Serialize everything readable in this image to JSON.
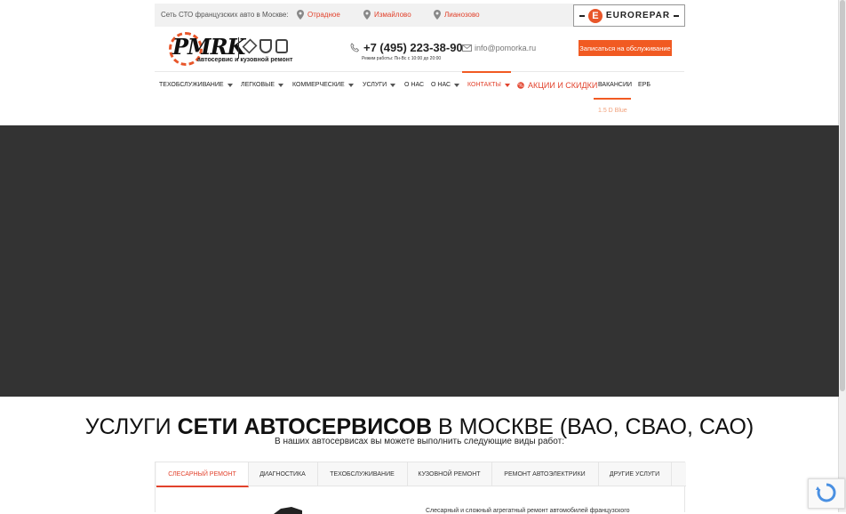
{
  "topbar": {
    "lead": "Сеть СТО французских авто в Москве:",
    "locations": [
      "Отрадное",
      "Измайлово",
      "Лианозово"
    ],
    "partner": "EUROREPAR"
  },
  "logo": {
    "name": "PMRK",
    "tagline": "автосервис и кузовной ремонт"
  },
  "contact": {
    "phone": "+7 (495) 223-38-90",
    "hours": "Режим работы: Пн-Вс с 10:00 до 20:00",
    "email": "info@pomorka.ru",
    "signup": "Записаться на обслуживание"
  },
  "nav": {
    "items": [
      "ТЕХОБСЛУЖИВАНИЕ",
      "ЛЕГКОВЫЕ",
      "КОММЕРЧЕСКИЕ",
      "УСЛУГИ",
      "О НАС",
      "О НАС",
      "КОНТАКТЫ",
      "АКЦИИ И СКИДКИ",
      "ВАКАНСИИ",
      "EPБ"
    ],
    "submenu": "1.5 D Blue"
  },
  "section": {
    "headline_a": "УСЛУГИ ",
    "headline_b": "СЕТИ АВТОСЕРВИСОВ",
    "headline_c": " В МОСКВЕ (ВАО, СВАО, САО)",
    "subline": "В наших автосервисах вы можете выполнить следующие виды работ:"
  },
  "tabs": {
    "items": [
      "СЛЕСАРНЫЙ РЕМОНТ",
      "ДИАГНОСТИКА",
      "ТЕХОБСЛУЖИВАНИЕ",
      "КУЗОВНОЙ РЕМОНТ",
      "РЕМОНТ АВТОЭЛЕКТРИКИ",
      "ДРУГИЕ УСЛУГИ"
    ],
    "content": "Слесарный и сложный агрегатный ремонт автомобилей французского"
  },
  "colors": {
    "accent": "#f15a22",
    "hero": "#333333"
  }
}
